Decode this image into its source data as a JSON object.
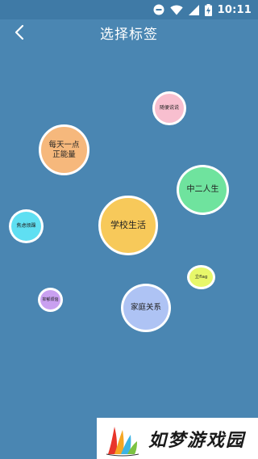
{
  "status_bar": {
    "time": "10:11",
    "icons": [
      "do-not-disturb-icon",
      "wifi-icon",
      "signal-icon",
      "battery-charging-icon"
    ]
  },
  "header": {
    "title": "选择标签",
    "back_icon": "back-arrow-icon"
  },
  "tags": [
    {
      "label": "随便说说",
      "color": "#f8bfcf"
    },
    {
      "label": "每天一点\n正能量",
      "color": "#f6b87c"
    },
    {
      "label": "中二人生",
      "color": "#6fe39e"
    },
    {
      "label": "焦虑烦躁",
      "color": "#5fdff2"
    },
    {
      "label": "学校生活",
      "color": "#f7c95a"
    },
    {
      "label": "立flag",
      "color": "#e7f76a"
    },
    {
      "label": "抑郁烦恼",
      "color": "#c9a0f0"
    },
    {
      "label": "家庭关系",
      "color": "#aec3f4"
    }
  ],
  "watermark": {
    "text": "如梦游戏园"
  }
}
